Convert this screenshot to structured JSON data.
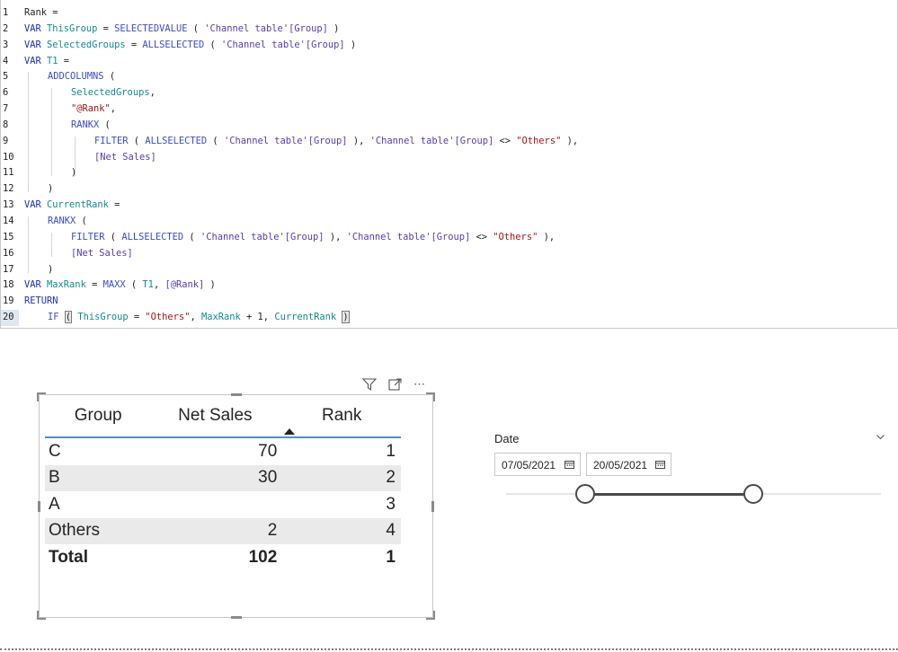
{
  "editor": {
    "lines": [
      {
        "n": "1",
        "indent": 0,
        "tokens": [
          {
            "t": "Rank =",
            "c": ""
          }
        ]
      },
      {
        "n": "2",
        "indent": 0,
        "tokens": [
          {
            "t": "VAR ",
            "c": "kw"
          },
          {
            "t": "ThisGroup",
            "c": "var"
          },
          {
            "t": " = ",
            "c": ""
          },
          {
            "t": "SELECTEDVALUE",
            "c": "fn"
          },
          {
            "t": " ( ",
            "c": ""
          },
          {
            "t": "'Channel table'[Group]",
            "c": "ref"
          },
          {
            "t": " )",
            "c": ""
          }
        ]
      },
      {
        "n": "3",
        "indent": 0,
        "tokens": [
          {
            "t": "VAR ",
            "c": "kw"
          },
          {
            "t": "SelectedGroups",
            "c": "var"
          },
          {
            "t": " = ",
            "c": ""
          },
          {
            "t": "ALLSELECTED",
            "c": "fn"
          },
          {
            "t": " ( ",
            "c": ""
          },
          {
            "t": "'Channel table'[Group]",
            "c": "ref"
          },
          {
            "t": " )",
            "c": ""
          }
        ]
      },
      {
        "n": "4",
        "indent": 0,
        "tokens": [
          {
            "t": "VAR ",
            "c": "kw"
          },
          {
            "t": "T1",
            "c": "var"
          },
          {
            "t": " =",
            "c": ""
          }
        ]
      },
      {
        "n": "5",
        "indent": 1,
        "tokens": [
          {
            "t": "ADDCOLUMNS",
            "c": "fn"
          },
          {
            "t": " (",
            "c": ""
          }
        ]
      },
      {
        "n": "6",
        "indent": 2,
        "tokens": [
          {
            "t": "SelectedGroups",
            "c": "var"
          },
          {
            "t": ",",
            "c": ""
          }
        ]
      },
      {
        "n": "7",
        "indent": 2,
        "tokens": [
          {
            "t": "\"@Rank\"",
            "c": "str"
          },
          {
            "t": ",",
            "c": ""
          }
        ]
      },
      {
        "n": "8",
        "indent": 2,
        "tokens": [
          {
            "t": "RANKX",
            "c": "fn"
          },
          {
            "t": " (",
            "c": ""
          }
        ]
      },
      {
        "n": "9",
        "indent": 3,
        "tokens": [
          {
            "t": "FILTER",
            "c": "fn"
          },
          {
            "t": " ( ",
            "c": ""
          },
          {
            "t": "ALLSELECTED",
            "c": "fn"
          },
          {
            "t": " ( ",
            "c": ""
          },
          {
            "t": "'Channel table'[Group]",
            "c": "ref"
          },
          {
            "t": " ), ",
            "c": ""
          },
          {
            "t": "'Channel table'[Group]",
            "c": "ref"
          },
          {
            "t": " <> ",
            "c": ""
          },
          {
            "t": "\"Others\"",
            "c": "str"
          },
          {
            "t": " ),",
            "c": ""
          }
        ]
      },
      {
        "n": "10",
        "indent": 3,
        "tokens": [
          {
            "t": "[Net Sales]",
            "c": "ref"
          }
        ]
      },
      {
        "n": "11",
        "indent": 2,
        "tokens": [
          {
            "t": ")",
            "c": ""
          }
        ]
      },
      {
        "n": "12",
        "indent": 1,
        "tokens": [
          {
            "t": ")",
            "c": ""
          }
        ]
      },
      {
        "n": "13",
        "indent": 0,
        "tokens": [
          {
            "t": "VAR ",
            "c": "kw"
          },
          {
            "t": "CurrentRank",
            "c": "var"
          },
          {
            "t": " =",
            "c": ""
          }
        ]
      },
      {
        "n": "14",
        "indent": 1,
        "tokens": [
          {
            "t": "RANKX",
            "c": "fn"
          },
          {
            "t": " (",
            "c": ""
          }
        ]
      },
      {
        "n": "15",
        "indent": 2,
        "tokens": [
          {
            "t": "FILTER",
            "c": "fn"
          },
          {
            "t": " ( ",
            "c": ""
          },
          {
            "t": "ALLSELECTED",
            "c": "fn"
          },
          {
            "t": " ( ",
            "c": ""
          },
          {
            "t": "'Channel table'[Group]",
            "c": "ref"
          },
          {
            "t": " ), ",
            "c": ""
          },
          {
            "t": "'Channel table'[Group]",
            "c": "ref"
          },
          {
            "t": " <> ",
            "c": ""
          },
          {
            "t": "\"Others\"",
            "c": "str"
          },
          {
            "t": " ),",
            "c": ""
          }
        ]
      },
      {
        "n": "16",
        "indent": 2,
        "tokens": [
          {
            "t": "[Net Sales]",
            "c": "ref"
          }
        ]
      },
      {
        "n": "17",
        "indent": 1,
        "tokens": [
          {
            "t": ")",
            "c": ""
          }
        ]
      },
      {
        "n": "18",
        "indent": 0,
        "tokens": [
          {
            "t": "VAR ",
            "c": "kw"
          },
          {
            "t": "MaxRank",
            "c": "var"
          },
          {
            "t": " = ",
            "c": ""
          },
          {
            "t": "MAXX",
            "c": "fn"
          },
          {
            "t": " ( ",
            "c": ""
          },
          {
            "t": "T1",
            "c": "var"
          },
          {
            "t": ", ",
            "c": ""
          },
          {
            "t": "[@Rank]",
            "c": "ref"
          },
          {
            "t": " )",
            "c": ""
          }
        ]
      },
      {
        "n": "19",
        "indent": 0,
        "tokens": [
          {
            "t": "RETURN",
            "c": "kw"
          }
        ]
      },
      {
        "n": "20",
        "indent": 1,
        "tokens": [
          {
            "t": "IF",
            "c": "fn"
          },
          {
            "t": " ",
            "c": ""
          },
          {
            "t": "(",
            "c": "brk"
          },
          {
            "t": " ",
            "c": ""
          },
          {
            "t": "ThisGroup",
            "c": "var"
          },
          {
            "t": " = ",
            "c": ""
          },
          {
            "t": "\"Others\"",
            "c": "str"
          },
          {
            "t": ", ",
            "c": ""
          },
          {
            "t": "MaxRank",
            "c": "var"
          },
          {
            "t": " + 1, ",
            "c": ""
          },
          {
            "t": "CurrentRank",
            "c": "var"
          },
          {
            "t": " ",
            "c": ""
          },
          {
            "t": ")",
            "c": "brk"
          }
        ]
      }
    ]
  },
  "table": {
    "headers": {
      "group": "Group",
      "net_sales": "Net Sales",
      "rank": "Rank"
    },
    "rows": [
      {
        "group": "C",
        "net_sales": "70",
        "rank": "1"
      },
      {
        "group": "B",
        "net_sales": "30",
        "rank": "2"
      },
      {
        "group": "A",
        "net_sales": "",
        "rank": "3"
      },
      {
        "group": "Others",
        "net_sales": "2",
        "rank": "4"
      }
    ],
    "total": {
      "group": "Total",
      "net_sales": "102",
      "rank": "1"
    },
    "header_icons": [
      "filter-icon",
      "focus-mode-icon",
      "more-options-icon"
    ]
  },
  "slicer": {
    "title": "Date",
    "start_date": "07/05/2021",
    "end_date": "20/05/2021",
    "range_start_fraction": 0.21,
    "range_end_fraction": 0.66
  }
}
